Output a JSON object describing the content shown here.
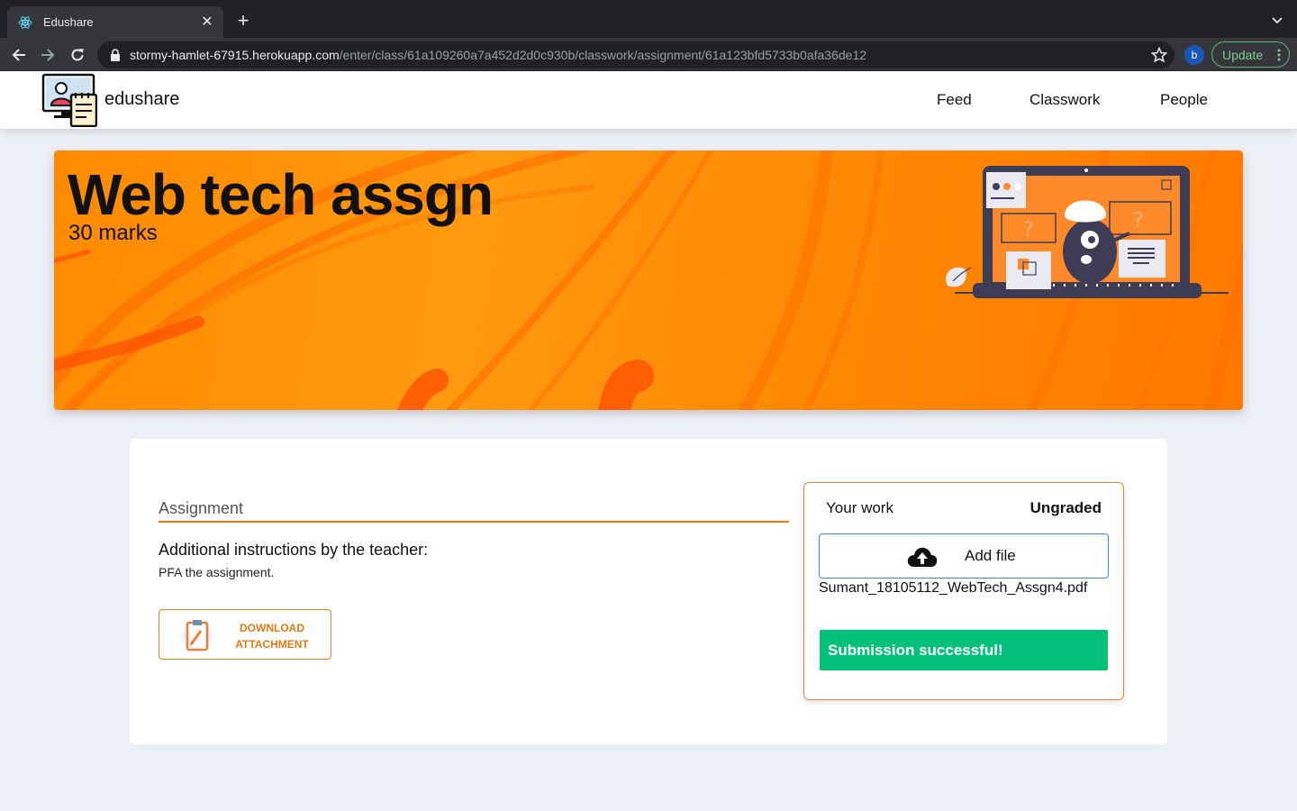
{
  "browser": {
    "tab_title": "Edushare",
    "url_host": "stormy-hamlet-67915.herokuapp.com",
    "url_path": "/enter/class/61a109260a7a452d2d0c930b/classwork/assignment/61a123bfd5733b0afa36de12",
    "profile_initial": "b",
    "update_label": "Update"
  },
  "header": {
    "brand": "edushare",
    "nav": [
      {
        "label": "Feed"
      },
      {
        "label": "Classwork"
      },
      {
        "label": "People"
      }
    ]
  },
  "banner": {
    "title": "Web tech assgn",
    "marks": "30 marks",
    "accent_color": "#ff8a00"
  },
  "assignment": {
    "section_title": "Assignment",
    "instructions_heading": "Additional instructions by the teacher:",
    "instructions_body": "PFA the assignment.",
    "download_label_line1": "DOWNLOAD",
    "download_label_line2": "ATTACHMENT"
  },
  "work": {
    "label": "Your work",
    "status": "Ungraded",
    "add_file_label": "Add file",
    "file_name": "Sumant_18105112_WebTech_Assgn4.pdf",
    "success_message": "Submission successful!",
    "success_color": "#00c07a"
  },
  "icons": {
    "tab_favicon": "react-atom-icon",
    "close": "close-icon",
    "new_tab": "plus-icon",
    "back": "back-arrow-icon",
    "forward": "forward-arrow-icon",
    "reload": "reload-icon",
    "lock": "lock-icon",
    "bookmark": "star-icon",
    "upload": "cloud-upload-icon",
    "clipboard": "clipboard-icon"
  }
}
